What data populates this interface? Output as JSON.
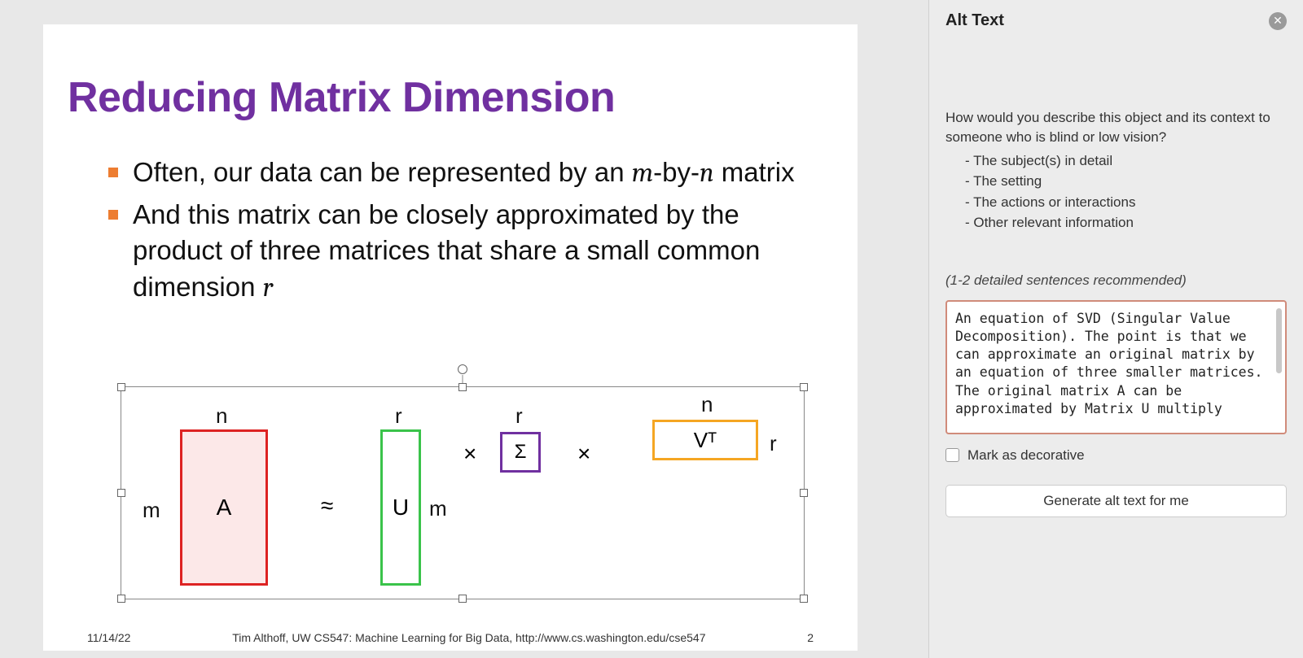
{
  "slide": {
    "title": "Reducing  Matrix Dimension",
    "bullets": [
      "Often, our data can be represented by an <em>m</em>-by-<em>n</em> matrix",
      "And this matrix can be closely approximated by the product of three matrices that share a small common dimension <em>r</em>"
    ],
    "footer_left": "11/14/22",
    "footer_center": "Tim Althoff, UW CS547: Machine Learning for Big Data, http://www.cs.washington.edu/cse547",
    "footer_right": "2",
    "diagram": {
      "A_label": "A",
      "U_label": "U",
      "S_label": "Σ",
      "V_label": "Vᵀ",
      "n": "n",
      "m": "m",
      "r": "r",
      "approx": "≈",
      "times": "×"
    }
  },
  "sidebar": {
    "title": "Alt Text",
    "prompt": "How would you describe this object and its context to someone who is blind or low vision?",
    "prompt_items": [
      "- The subject(s) in detail",
      "- The setting",
      "- The actions or interactions",
      "- Other relevant information"
    ],
    "hint": "(1-2 detailed sentences recommended)",
    "textarea_value": "An equation of SVD (Singular Value Decomposition). The point is that we can approximate an original matrix by an equation of three smaller matrices. The original matrix A can be approximated by Matrix U multiply \\Sigma matrix multiple the transpose of the V matrix.",
    "decorative_label": "Mark as decorative",
    "generate_label": "Generate alt text for me"
  }
}
